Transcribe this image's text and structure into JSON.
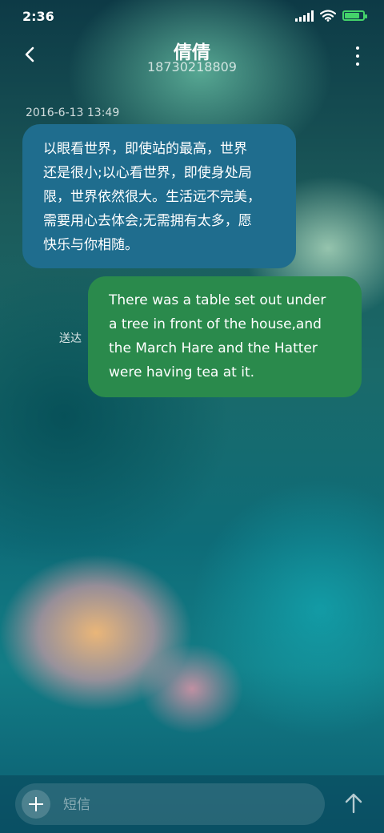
{
  "status_bar": {
    "time": "2:36"
  },
  "header": {
    "contact_name": "倩倩",
    "phone_number": "18730218809"
  },
  "conversation": {
    "timestamp": "2016-6-13 13:49",
    "incoming_message_lines": [
      "以眼看世界，即使站的最高，世界",
      "还是很小;以心看世界，即使身处局",
      "限，世界依然很大。生活远不完美，",
      "需要用心去体会;无需拥有太多，愿",
      "快乐与你相随。"
    ],
    "outgoing_message_lines": [
      "There was a table set out under",
      "a tree in front of the house,and",
      "the March Hare and the Hatter",
      "were having tea at it."
    ],
    "delivered_label": "送达"
  },
  "composer": {
    "placeholder": "短信"
  },
  "icons": {
    "back": "chevron-left-icon",
    "more": "more-vertical-icon",
    "add": "plus-icon",
    "send": "send-arrow-up-icon",
    "signal": "signal-icon",
    "wifi": "wifi-icon",
    "battery": "battery-charging-icon"
  },
  "colors": {
    "incoming_bubble": "#1f6d8e",
    "outgoing_bubble": "#2a8a4c",
    "battery": "#44d36a"
  }
}
